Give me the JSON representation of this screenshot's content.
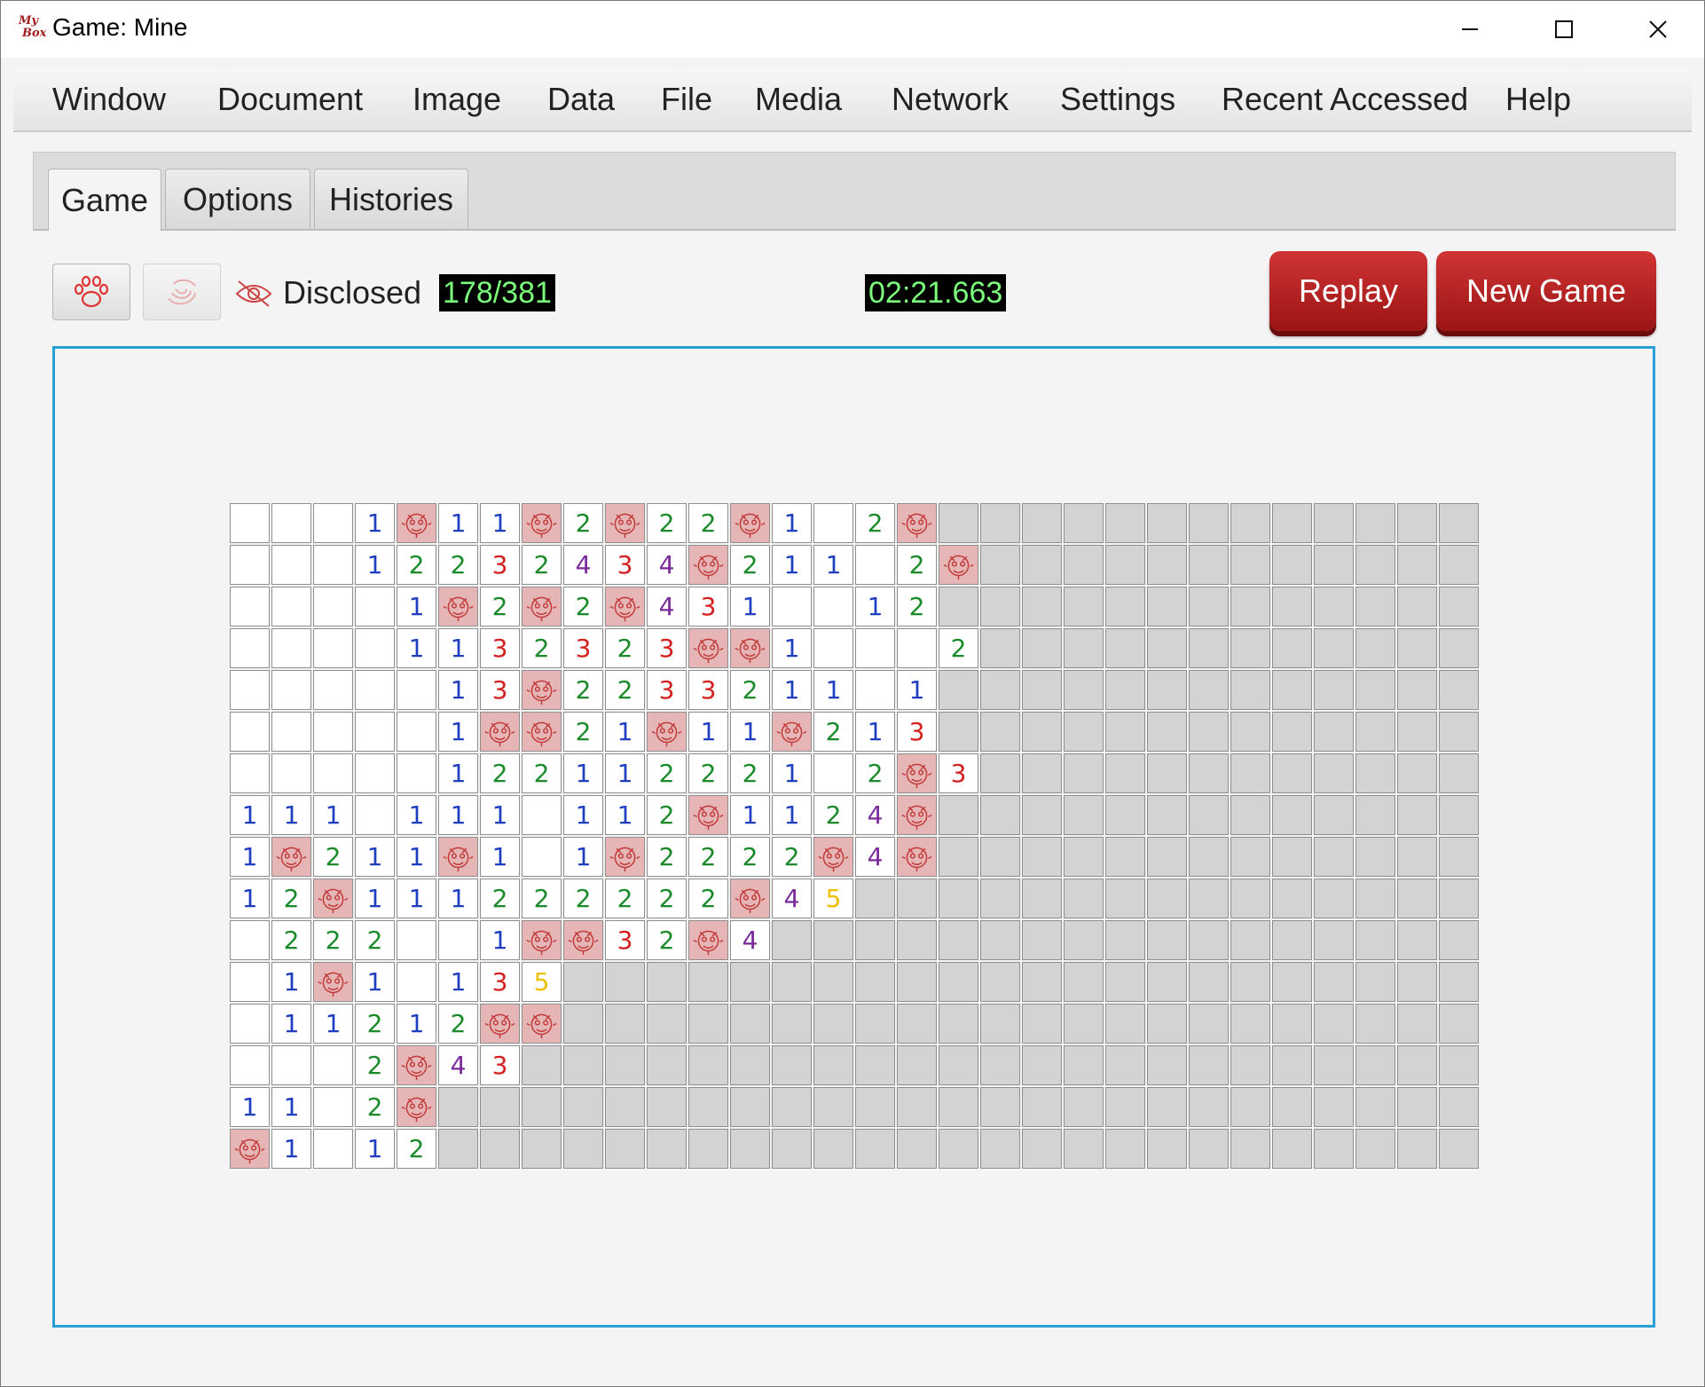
{
  "window": {
    "title": "Game: Mine",
    "logo_text": [
      "My",
      "Box"
    ]
  },
  "menu": [
    "Window",
    "Document",
    "Image",
    "Data",
    "File",
    "Media",
    "Network",
    "Settings",
    "Recent Accessed",
    "Help"
  ],
  "tabs": [
    "Game",
    "Options",
    "Histories"
  ],
  "active_tab": "Game",
  "toolbar": {
    "disclosed_label": "Disclosed",
    "disclosed_count": "178/381",
    "timer": "02:21.663",
    "replay_label": "Replay",
    "new_game_label": "New Game"
  },
  "icons": {
    "hint_button": "paw-icon",
    "disabled_button": "swirl-icon",
    "disclosed": "eye-icon"
  },
  "board": {
    "legend": "digits = adjacent mine count, . = open empty, M = mine, # = covered",
    "rows": [
      "...1M11M2M22M1.2M##############",
      "...12232434M211.2M##############",
      "....1M2M2M431..12##############",
      "....1132323MM1...2##############",
      ".....13M2233211.1##############",
      ".....1MM21M11M213##############",
      ".....122112221 2M3##############",
      "111.111.112M1124M##############",
      "1M211M1.1M2222M4M##############",
      "12M111222222M45################",
      ".222..1MM32M4##################",
      ".1M1.135########################",
      ".11212MM########################",
      "...2M43#########################",
      "11.2M###########################",
      "M1.12###########################"
    ],
    "columns": 30
  },
  "colors": {
    "accent_red": "#b01e1e",
    "lcd_bg": "#000000",
    "lcd_fg": "#7cff7c",
    "panel_border": "#2a9fd6",
    "n1": "#1f3fbf",
    "n2": "#1a8a2a",
    "n3": "#d32020",
    "n4": "#7a2a9a",
    "n5": "#f0c000"
  }
}
